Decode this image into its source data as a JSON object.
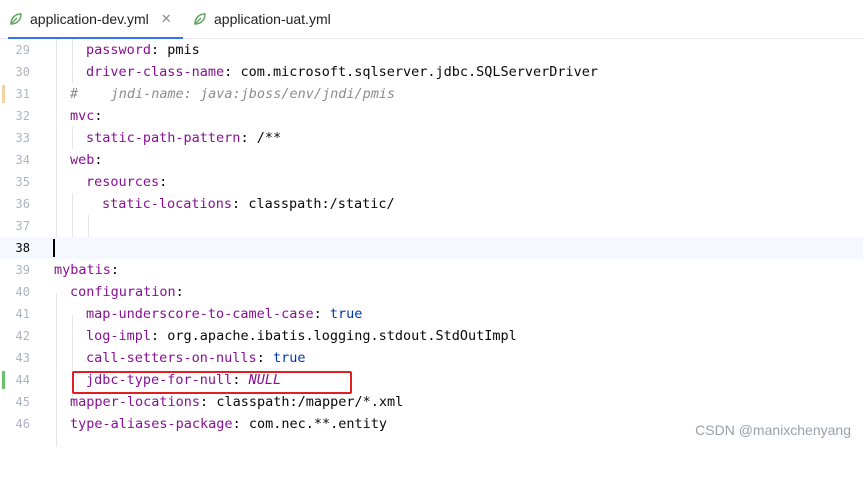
{
  "tabs": [
    {
      "label": "application-dev.yml",
      "close": "✕",
      "icon": "yaml-file-icon",
      "active": true
    },
    {
      "label": "application-uat.yml",
      "icon": "yaml-file-icon",
      "active": false
    }
  ],
  "lines": [
    {
      "num": "29",
      "key": "password",
      "sep": ": ",
      "value": "pmis"
    },
    {
      "num": "30",
      "key": "driver-class-name",
      "sep": ": ",
      "value": "com.microsoft.sqlserver.jdbc.SQLServerDriver"
    },
    {
      "num": "31",
      "comment": "#    jndi-name: java:jboss/env/jndi/pmis"
    },
    {
      "num": "32",
      "key": "mvc",
      "sep": ":"
    },
    {
      "num": "33",
      "key": "static-path-pattern",
      "sep": ": ",
      "value": "/**"
    },
    {
      "num": "34",
      "key": "web",
      "sep": ":"
    },
    {
      "num": "35",
      "key": "resources",
      "sep": ":"
    },
    {
      "num": "36",
      "key": "static-locations",
      "sep": ": ",
      "value": "classpath:/static/"
    },
    {
      "num": "37"
    },
    {
      "num": "38"
    },
    {
      "num": "39",
      "key": "mybatis",
      "sep": ":"
    },
    {
      "num": "40",
      "key": "configuration",
      "sep": ":"
    },
    {
      "num": "41",
      "key": "map-underscore-to-camel-case",
      "sep": ": ",
      "value": "true"
    },
    {
      "num": "42",
      "key": "log-impl",
      "sep": ": ",
      "value": "org.apache.ibatis.logging.stdout.StdOutImpl"
    },
    {
      "num": "43",
      "key": "call-setters-on-nulls",
      "sep": ": ",
      "value": "true"
    },
    {
      "num": "44",
      "key": "jdbc-type-for-null",
      "sep": ": ",
      "value": "NULL"
    },
    {
      "num": "45",
      "key": "mapper-locations",
      "sep": ": ",
      "value": "classpath:/mapper/*.xml"
    },
    {
      "num": "46",
      "key": "type-aliases-package",
      "sep": ": ",
      "value": "com.nec.**.entity"
    }
  ],
  "watermark": "CSDN @manixchenyang",
  "colors": {
    "key": "#871094",
    "keyword_value": "#0033b3",
    "comment": "#8c8c8c",
    "current_line": "#f5f8fe",
    "highlight_box": "#e02020",
    "tab_underline": "#3574f0"
  }
}
